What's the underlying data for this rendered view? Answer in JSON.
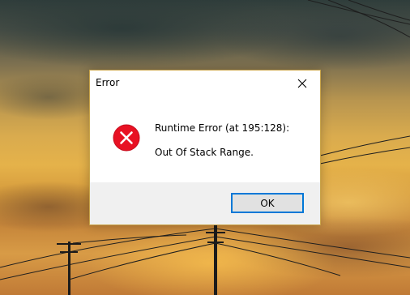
{
  "dialog": {
    "title": "Error",
    "close_icon": "close-icon",
    "icon": "error-icon",
    "message_line1": "Runtime Error (at 195:128):",
    "message_line2": "Out Of Stack Range.",
    "ok_label": "OK"
  },
  "colors": {
    "error_icon": "#e81123",
    "button_focus_border": "#0078d7",
    "footer_background": "#f0f0f0"
  }
}
